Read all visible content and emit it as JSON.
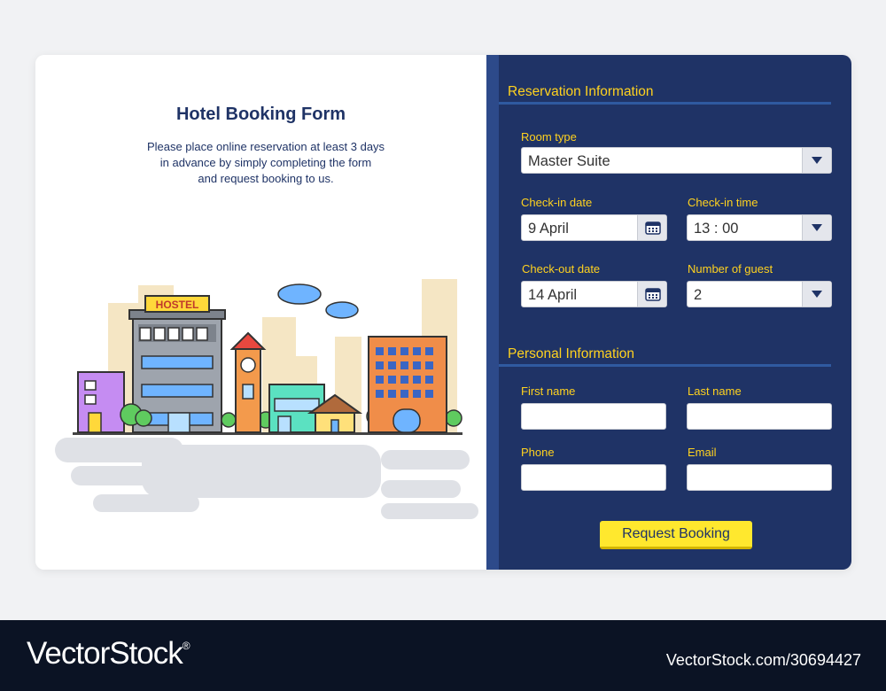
{
  "form": {
    "title": "Hotel Booking Form",
    "description": [
      "Please place online reservation at least 3 days",
      "in advance by simply completing the form",
      "and request booking to us."
    ],
    "hostel_sign": "HOSTEL",
    "reservation_section": "Reservation Information",
    "personal_section": "Personal Information",
    "room_type": {
      "label": "Room type",
      "value": "Master Suite"
    },
    "checkin_date": {
      "label": "Check-in date",
      "value": "9 April"
    },
    "checkin_time": {
      "label": "Check-in time",
      "value": "13 : 00"
    },
    "checkout_date": {
      "label": "Check-out date",
      "value": "14 April"
    },
    "guests": {
      "label": "Number of guest",
      "value": "2"
    },
    "first_name": {
      "label": "First name",
      "value": ""
    },
    "last_name": {
      "label": "Last name",
      "value": ""
    },
    "phone": {
      "label": "Phone",
      "value": ""
    },
    "email": {
      "label": "Email",
      "value": ""
    },
    "submit_label": "Request Booking"
  },
  "footer": {
    "logo_text": "VectorStock",
    "logo_mark": "®",
    "url": "VectorStock.com/30694427"
  },
  "colors": {
    "panel": "#1f3366",
    "accent_yellow": "#ffd21f",
    "button_yellow": "#ffe82e",
    "title_blue": "#1f3366"
  },
  "icons": [
    "calendar-icon",
    "dropdown-arrow-icon"
  ]
}
